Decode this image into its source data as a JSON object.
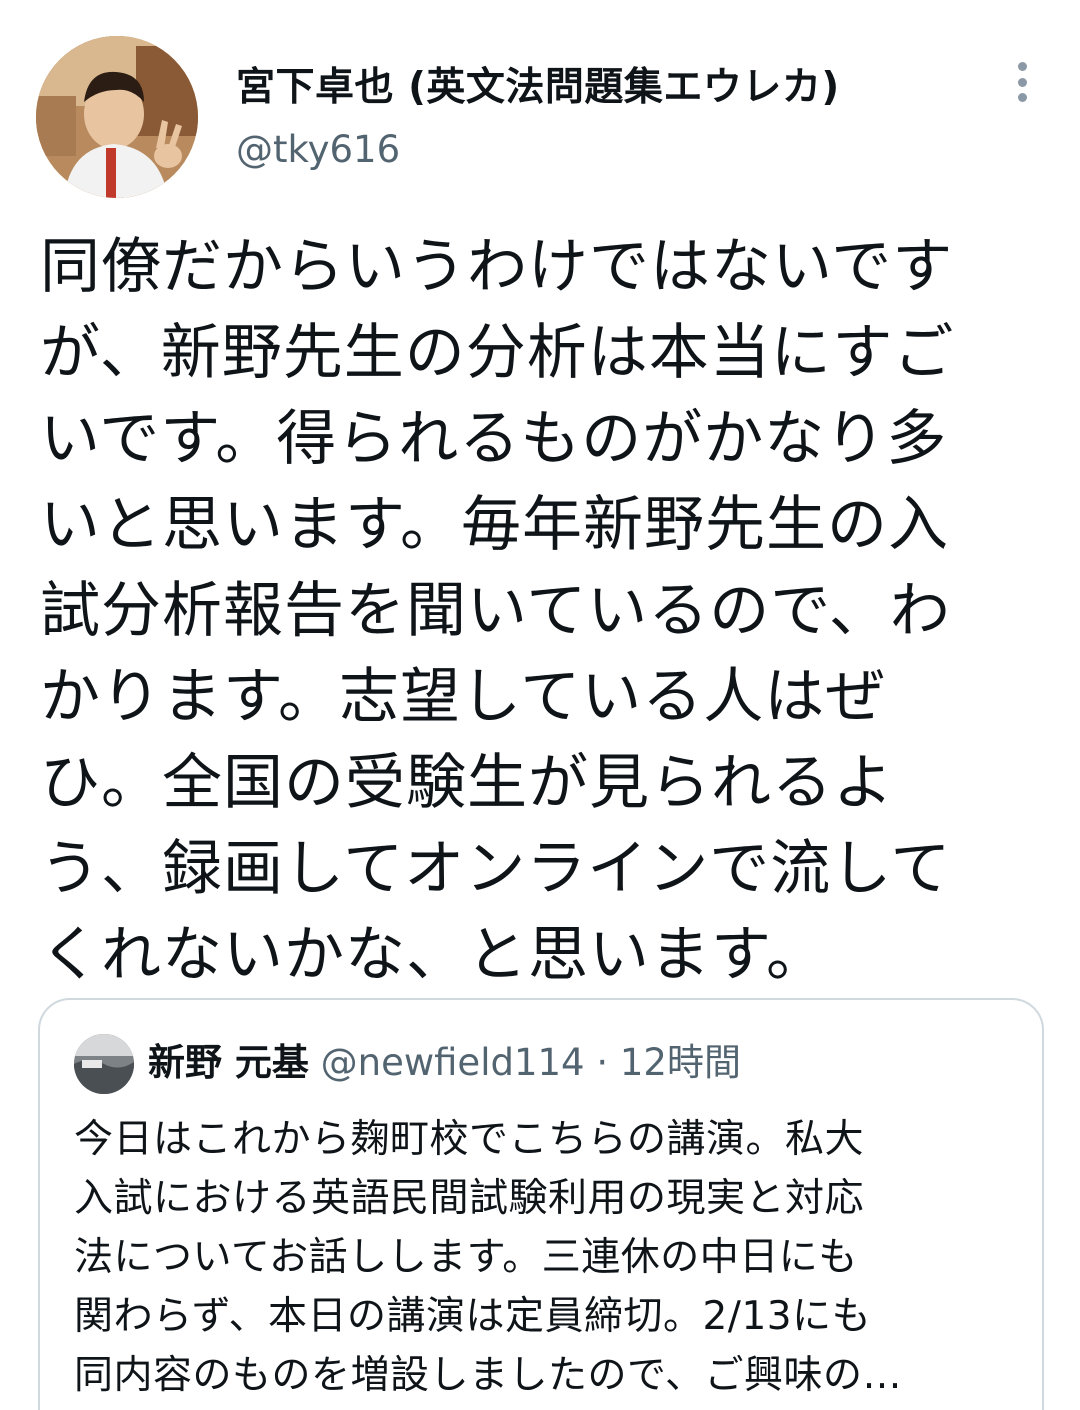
{
  "tweet": {
    "author": {
      "name": "宮下卓也 (英文法問題集エウレカ)",
      "handle": "@tky616"
    },
    "more_icon": "more-vertical-icon",
    "text_lines": [
      "同僚だからいうわけではないです",
      "が、新野先生の分析は本当にすご",
      "いです。得られるものがかなり多",
      "いと思います。毎年新野先生の入",
      "試分析報告を聞いているので、わ",
      "かります。志望している人はぜ",
      "ひ。全国の受験生が見られるよ",
      "う、録画してオンラインで流して",
      "くれないかな、と思います。"
    ]
  },
  "quoted_tweet": {
    "author": {
      "name": "新野 元基",
      "handle": "@newfield114",
      "separator": "·",
      "time": "12時間"
    },
    "text_lines": [
      "今日はこれから麹町校でこちらの講演。私大",
      "入試における英語民間試験利用の現実と対応",
      "法についてお話しします。三連休の中日にも",
      "関わらず、本日の講演は定員締切。2/13にも",
      "同内容のものを増設しましたので、ご興味の…"
    ]
  },
  "colors": {
    "text_primary": "#0f1419",
    "text_secondary": "#536471",
    "border": "#cfd9de",
    "background": "#ffffff"
  }
}
